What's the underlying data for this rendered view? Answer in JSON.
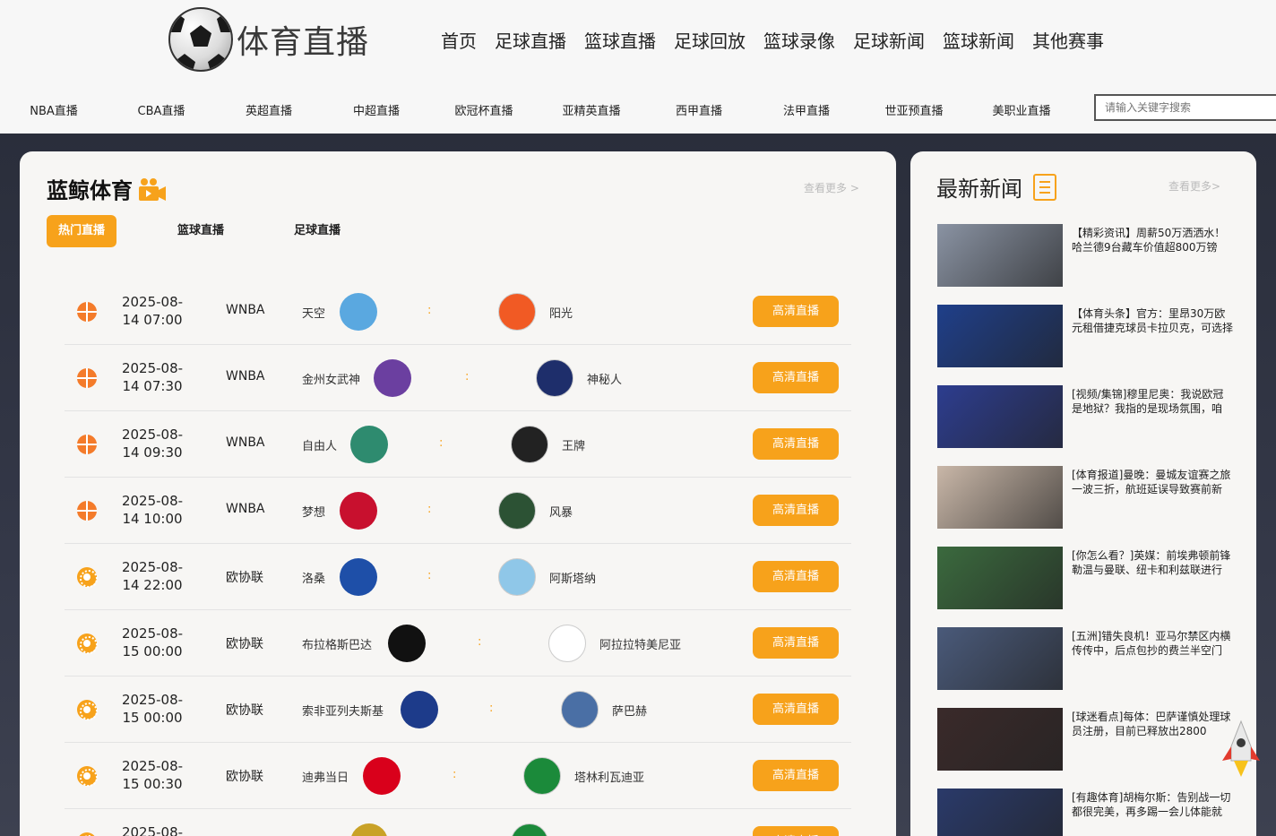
{
  "site": {
    "logo_text": "体育直播"
  },
  "main_nav": [
    "首页",
    "足球直播",
    "篮球直播",
    "足球回放",
    "篮球录像",
    "足球新闻",
    "篮球新闻",
    "其他赛事"
  ],
  "sub_nav": [
    "NBA直播",
    "CBA直播",
    "英超直播",
    "中超直播",
    "欧冠杯直播",
    "亚精英直播",
    "西甲直播",
    "法甲直播",
    "世亚预直播",
    "美职业直播"
  ],
  "search": {
    "placeholder": "请输入关键字搜索"
  },
  "live_section": {
    "title": "蓝鲸体育",
    "more_label": "查看更多 >",
    "tabs": [
      "热门直播",
      "篮球直播",
      "足球直播"
    ],
    "active_tab": 0,
    "button_label": "高清直播",
    "colon": ":",
    "matches": [
      {
        "sport": "basketball",
        "date": "2025-08-",
        "time": "14 07:00",
        "league": "WNBA",
        "home": "天空",
        "away": "阳光",
        "home_color": "#5aa8e0",
        "away_color": "#f15a24"
      },
      {
        "sport": "basketball",
        "date": "2025-08-",
        "time": "14 07:30",
        "league": "WNBA",
        "home": "金州女武神",
        "away": "神秘人",
        "home_color": "#6b3fa0",
        "away_color": "#1e2e6b"
      },
      {
        "sport": "basketball",
        "date": "2025-08-",
        "time": "14 09:30",
        "league": "WNBA",
        "home": "自由人",
        "away": "王牌",
        "home_color": "#2e8b6f",
        "away_color": "#222222"
      },
      {
        "sport": "basketball",
        "date": "2025-08-",
        "time": "14 10:00",
        "league": "WNBA",
        "home": "梦想",
        "away": "风暴",
        "home_color": "#c8102e",
        "away_color": "#2c5234"
      },
      {
        "sport": "soccer",
        "date": "2025-08-",
        "time": "14 22:00",
        "league": "欧协联",
        "home": "洛桑",
        "away": "阿斯塔纳",
        "home_color": "#1e4fa8",
        "away_color": "#8fc7e8"
      },
      {
        "sport": "soccer",
        "date": "2025-08-",
        "time": "15 00:00",
        "league": "欧协联",
        "home": "布拉格斯巴达",
        "away": "阿拉拉特美尼亚",
        "home_color": "#111111",
        "away_color": "#ffffff"
      },
      {
        "sport": "soccer",
        "date": "2025-08-",
        "time": "15 00:00",
        "league": "欧协联",
        "home": "索非亚列夫斯基",
        "away": "萨巴赫",
        "home_color": "#1d3b8a",
        "away_color": "#4a6fa5"
      },
      {
        "sport": "soccer",
        "date": "2025-08-",
        "time": "15 00:30",
        "league": "欧协联",
        "home": "迪弗当日",
        "away": "塔林利瓦迪亚",
        "home_color": "#d9001b",
        "away_color": "#1b8a3a"
      },
      {
        "sport": "soccer",
        "date": "2025-08-",
        "time": "",
        "league": "",
        "home": "",
        "away": "",
        "home_color": "#c9a227",
        "away_color": "#1b8a3a"
      }
    ]
  },
  "news_section": {
    "title": "最新新闻",
    "more_label": "查看更多>",
    "items": [
      {
        "text": "【精彩资讯】周薪50万洒洒水！哈兰德9台藏车价值超800万镑",
        "thumb_color": "#8a93a3"
      },
      {
        "text": "【体育头条】官方：里昂30万欧元租借捷克球员卡拉贝克，可选择",
        "thumb_color": "#1f3f8a"
      },
      {
        "text": "[视频/集锦]穆里尼奥：我说欧冠是地狱？我指的是现场氛围，咱",
        "thumb_color": "#2d3d8f"
      },
      {
        "text": "[体育报道]曼晚：曼城友谊赛之旅一波三折，航班延误导致赛前新",
        "thumb_color": "#c9b7a8"
      },
      {
        "text": "[你怎么看？]英媒：前埃弗顿前锋勒温与曼联、纽卡和利兹联进行",
        "thumb_color": "#3b6a3e"
      },
      {
        "text": "[五洲]错失良机！亚马尔禁区内横传传中，后点包抄的费兰半空门",
        "thumb_color": "#4a5a7a"
      },
      {
        "text": "[球迷看点]每体：巴萨谨慎处理球员注册，目前已释放出2800",
        "thumb_color": "#3a2a2a"
      },
      {
        "text": "[有趣体育]胡梅尔斯：告别战一切都很完美，再多踢一会儿体能就",
        "thumb_color": "#2a3a6a"
      }
    ]
  }
}
